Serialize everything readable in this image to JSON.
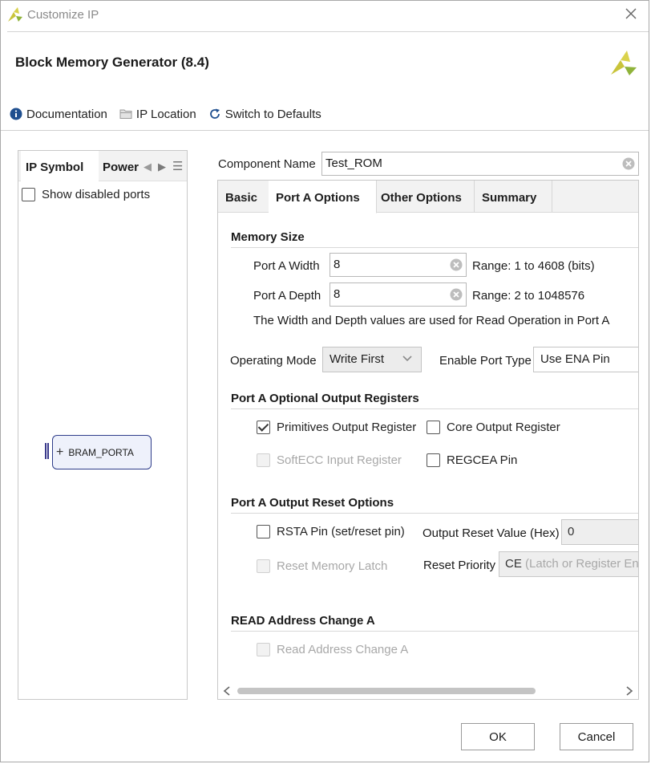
{
  "window": {
    "title": "Customize IP"
  },
  "header": {
    "title": "Block Memory Generator (8.4)"
  },
  "toolbar": {
    "documentation": "Documentation",
    "ip_location": "IP Location",
    "switch_defaults": "Switch to Defaults"
  },
  "left_panel": {
    "tabs": [
      "IP Symbol",
      "Power"
    ],
    "show_disabled_ports": "Show disabled ports",
    "show_disabled_checked": false,
    "port_label": "BRAM_PORTA"
  },
  "component": {
    "label": "Component Name",
    "value": "Test_ROM"
  },
  "tabs": [
    "Basic",
    "Port A Options",
    "Other Options",
    "Summary"
  ],
  "active_tab": "Port A Options",
  "memory_size": {
    "title": "Memory Size",
    "width_label": "Port A Width",
    "width_value": "8",
    "width_range": "Range: 1 to 4608 (bits)",
    "depth_label": "Port A Depth",
    "depth_value": "8",
    "depth_range": "Range: 2 to 1048576",
    "note": "The Width and Depth values are used for Read Operation in Port A"
  },
  "operating_mode": {
    "label": "Operating Mode",
    "value": "Write First"
  },
  "enable_port": {
    "label": "Enable Port Type",
    "value": "Use ENA Pin"
  },
  "output_registers": {
    "title": "Port A Optional Output Registers",
    "primitives": "Primitives Output Register",
    "primitives_checked": true,
    "core": "Core Output Register",
    "core_checked": false,
    "softecc": "SoftECC Input Register",
    "regcea": "REGCEA Pin",
    "regcea_checked": false
  },
  "reset_options": {
    "title": "Port A Output Reset Options",
    "rsta": "RSTA Pin (set/reset pin)",
    "rsta_checked": false,
    "reset_value_label": "Output Reset Value (Hex)",
    "reset_value": "0",
    "reset_latch": "Reset Memory Latch",
    "reset_priority_label": "Reset Priority",
    "reset_priority_prefix": "CE",
    "reset_priority_detail": "(Latch or Register Ena"
  },
  "read_address": {
    "title": "READ Address Change A",
    "checkbox": "Read Address Change A"
  },
  "buttons": {
    "ok": "OK",
    "cancel": "Cancel"
  },
  "colors": {
    "brand_yellow": "#c8c83a",
    "brand_green": "#8db33a",
    "accent": "#1f5fa8"
  }
}
